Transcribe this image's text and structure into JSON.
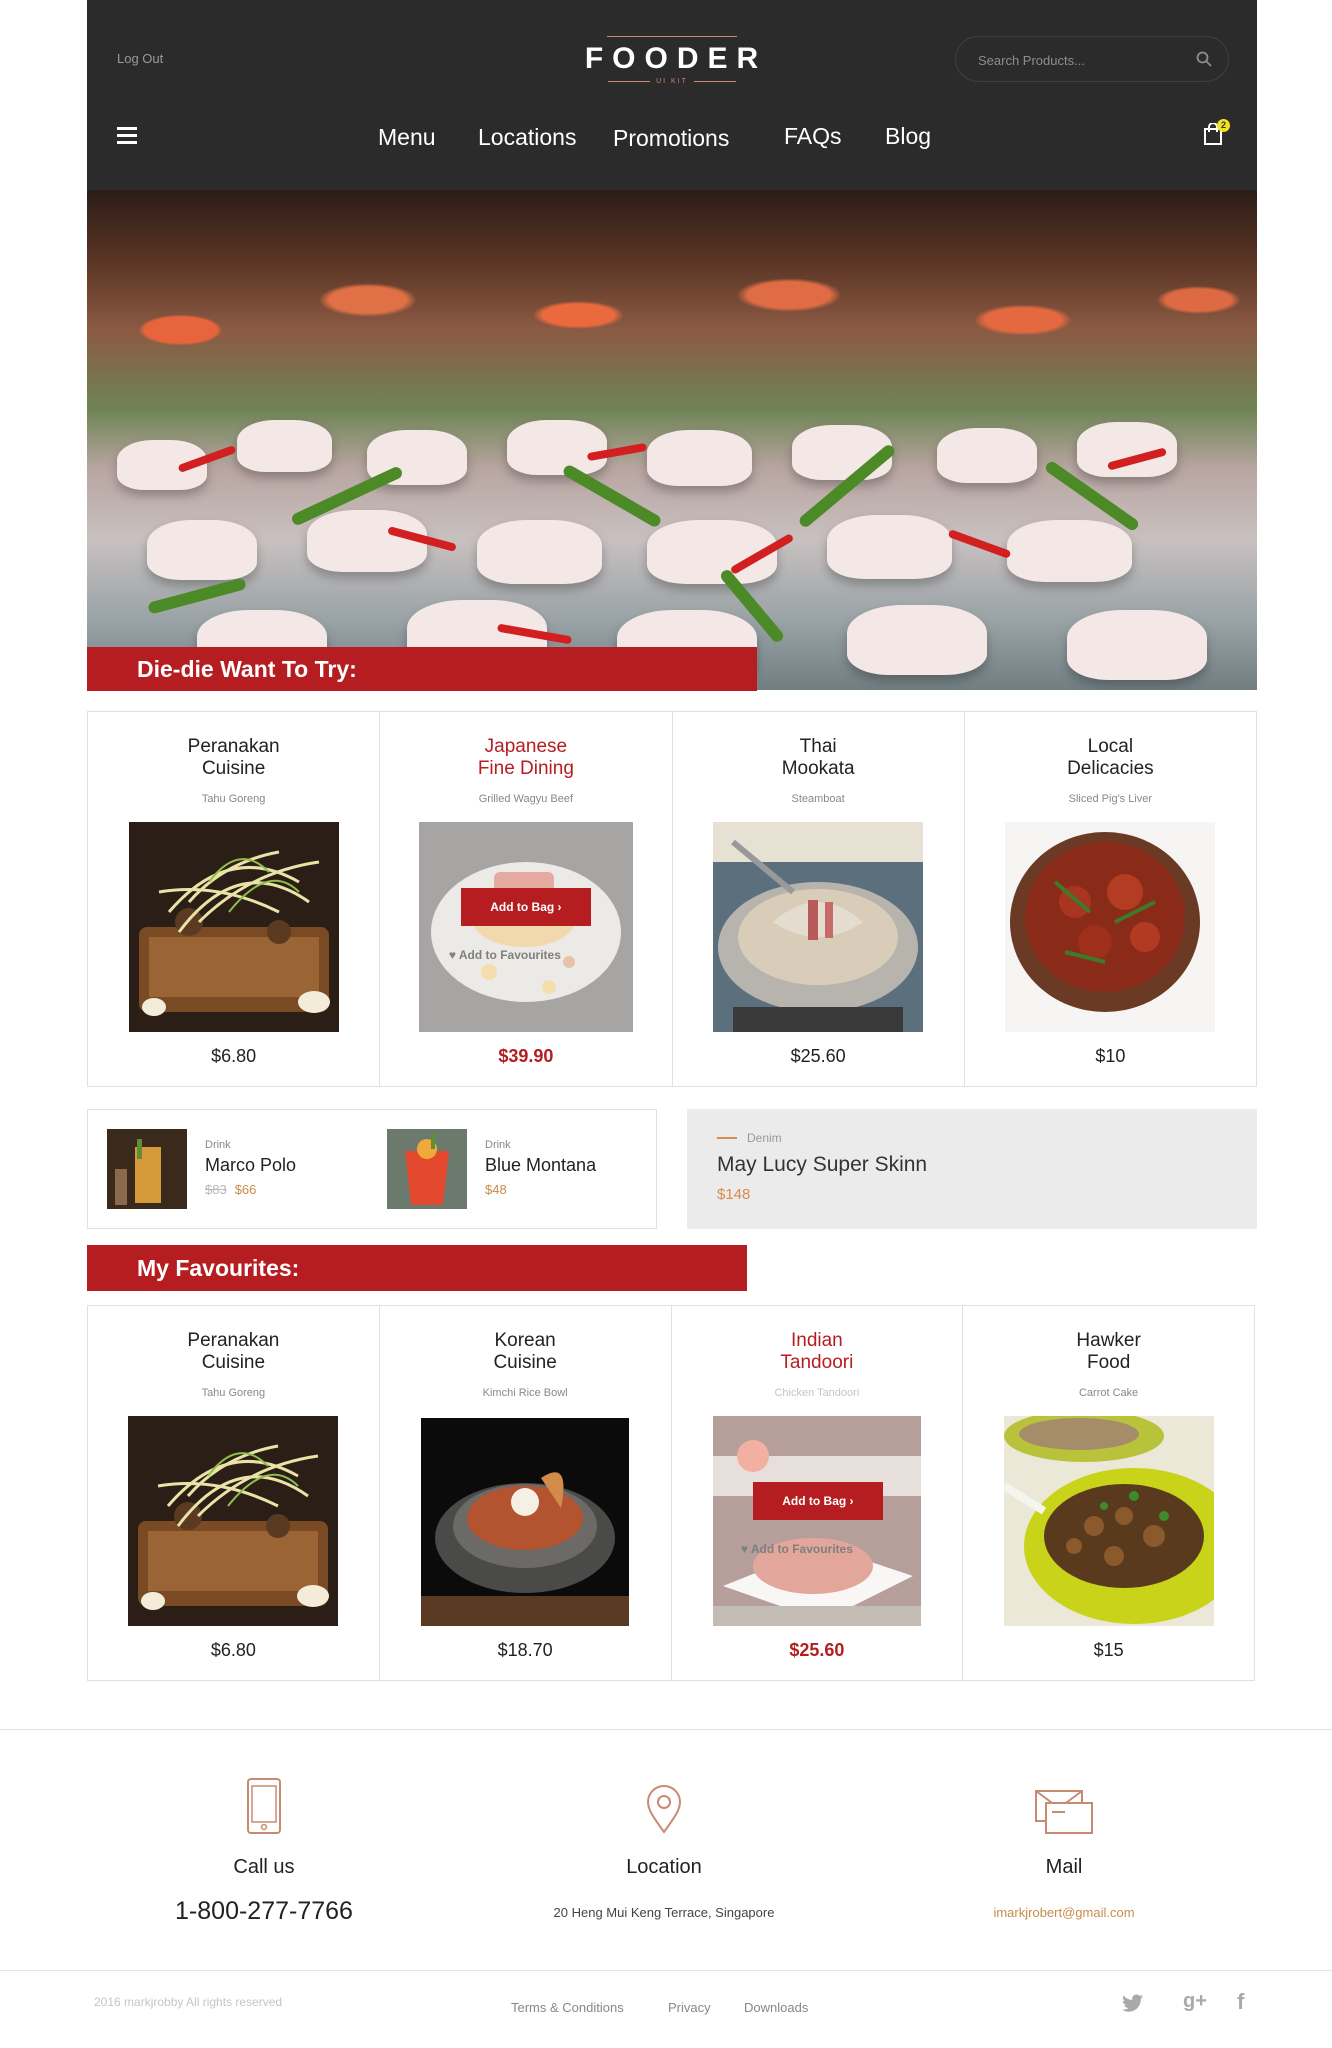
{
  "header": {
    "logout": "Log Out",
    "brand": "FOODER",
    "brand_sub": "UI KIT",
    "search_placeholder": "Search Products...",
    "nav": [
      "Menu",
      "Locations",
      "Promotions",
      "FAQs",
      "Blog"
    ],
    "cart_count": "2"
  },
  "hero": {
    "banner": "Die-die Want To Try:"
  },
  "featured": [
    {
      "title1": "Peranakan",
      "title2": "Cuisine",
      "subtitle": "Tahu Goreng",
      "price": "$6.80",
      "highlighted": false
    },
    {
      "title1": "Japanese",
      "title2": "Fine Dining",
      "subtitle": "Grilled Wagyu Beef",
      "price": "$39.90",
      "highlighted": true,
      "add_to_bag": "Add to Bag",
      "add_to_favourites": "Add to Favourites"
    },
    {
      "title1": "Thai",
      "title2": "Mookata",
      "subtitle": "Steamboat",
      "price": "$25.60",
      "highlighted": false
    },
    {
      "title1": "Local",
      "title2": "Delicacies",
      "subtitle": "Sliced Pig's Liver",
      "price": "$10",
      "highlighted": false
    }
  ],
  "drinks": [
    {
      "type": "Drink",
      "name": "Marco Polo",
      "old_price": "$83",
      "price": "$66"
    },
    {
      "type": "Drink",
      "name": "Blue Montana",
      "price": "$48"
    }
  ],
  "promo": {
    "type": "Denim",
    "name": "May Lucy Super Skinn",
    "price": "$148"
  },
  "favourites_banner": "My Favourites:",
  "favourites": [
    {
      "title1": "Peranakan",
      "title2": "Cuisine",
      "subtitle": "Tahu Goreng",
      "price": "$6.80",
      "highlighted": false
    },
    {
      "title1": "Korean",
      "title2": "Cuisine",
      "subtitle": "Kimchi Rice Bowl",
      "price": "$18.70",
      "highlighted": false
    },
    {
      "title1": "Indian",
      "title2": "Tandoori",
      "subtitle": "Chicken Tandoori",
      "price": "$25.60",
      "highlighted": true,
      "add_to_bag": "Add to Bag",
      "add_to_favourites": "Add to Favourites"
    },
    {
      "title1": "Hawker",
      "title2": "Food",
      "subtitle": "Carrot Cake",
      "price": "$15",
      "highlighted": false
    }
  ],
  "contact": {
    "call_label": "Call us",
    "call_value": "1-800-277-7766",
    "location_label": "Location",
    "location_value": "20 Heng Mui Keng Terrace, Singapore",
    "mail_label": "Mail",
    "mail_value": "imarkjrobert@gmail.com"
  },
  "footer": {
    "copyright": "2016 markjrobby All rights reserved",
    "links": [
      "Terms & Conditions",
      "Privacy",
      "Downloads"
    ]
  },
  "icons": [
    "search-icon",
    "menu-icon",
    "bag-icon",
    "phone-icon",
    "location-pin-icon",
    "mail-icon",
    "twitter-icon",
    "google-plus-icon",
    "facebook-icon",
    "heart-icon",
    "chevron-right-icon"
  ],
  "colors": {
    "header_bg": "#2b2b2b",
    "accent_red": "#b51d21",
    "accent_orange": "#d98b4c",
    "promo_bg": "#ebebeb"
  }
}
